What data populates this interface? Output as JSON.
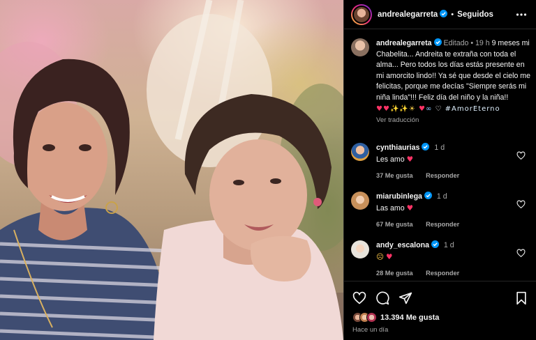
{
  "post": {
    "username": "andrealegarreta",
    "follow_state": "Seguidos",
    "separator": "•"
  },
  "caption": {
    "username": "andrealegarreta",
    "edited_label": "Editado",
    "time": "19 h",
    "text": "9 meses mi Chabelita... Andreita te extraña con toda el alma... Pero todos los días estás presente en mi amorcito lindo!! Ya sé que desde el cielo me felicitas, porque me decías \"Siempre serás mi niña linda\"!!! Feliz día del niño y la niña!!",
    "emojis": [
      "heart",
      "heart",
      "sparkles",
      "sparkles",
      "sun",
      "heart",
      "infinity",
      "white-heart"
    ],
    "hashtag": "#AmorEterno",
    "see_translation": "Ver traducción"
  },
  "comments": [
    {
      "username": "cynthiaurias",
      "time": "1 d",
      "text": "Les amo",
      "emoji": "heart",
      "likes": "37 Me gusta",
      "reply": "Responder"
    },
    {
      "username": "miarubinlega",
      "time": "1 d",
      "text": "Las amo",
      "emoji": "heart",
      "likes": "67 Me gusta",
      "reply": "Responder"
    },
    {
      "username": "andy_escalona",
      "time": "1 d",
      "text": "",
      "emoji": "crying-face heart",
      "likes": "28 Me gusta",
      "reply": "Responder"
    }
  ],
  "footer": {
    "likes_count": "13.394 Me gusta",
    "time_ago": "Hace un día"
  },
  "colors": {
    "background": "#000000",
    "text_primary": "#f5f5f5",
    "text_secondary": "#a8a8a8",
    "verified_blue": "#0095f6",
    "heart_red": "#ff3366"
  },
  "icons": [
    "verified-badge-icon",
    "more-options-icon",
    "heart-outline-icon",
    "comment-icon",
    "share-icon",
    "bookmark-icon"
  ]
}
